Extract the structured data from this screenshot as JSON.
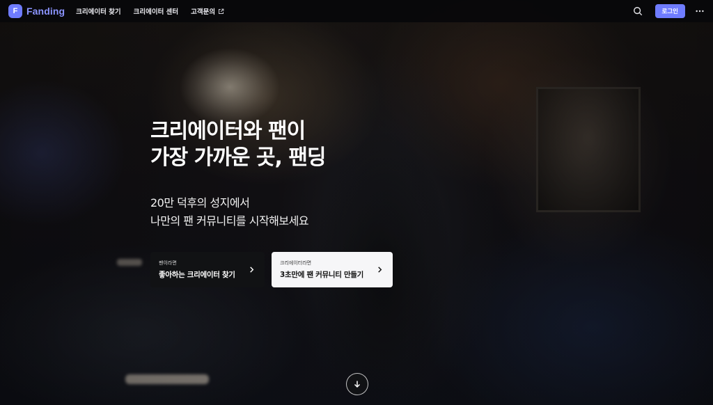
{
  "brand": {
    "name": "Fanding",
    "mark": "F"
  },
  "nav": {
    "links": [
      {
        "label": "크리에이터 찾기"
      },
      {
        "label": "크리에이터 센터"
      },
      {
        "label": "고객문의"
      }
    ],
    "login_label": "로그인"
  },
  "hero": {
    "title_line1": "크리에이터와 팬이",
    "title_line2": "가장 가까운 곳, 팬딩",
    "subtitle_line1": "20만 덕후의 성지에서",
    "subtitle_line2": "나만의 팬 커뮤니티를 시작해보세요",
    "cta_fan": {
      "caption": "팬이라면",
      "label": "좋아하는 크리에이터 찾기"
    },
    "cta_creator": {
      "caption": "크리에이터라면",
      "label": "3초만에 팬 커뮤니티 만들기"
    }
  },
  "icons": {
    "search": "search-icon",
    "more": "more-horizontal-icon",
    "external": "external-link-icon",
    "chevron": "chevron-right-icon",
    "scroll": "arrow-down-icon"
  },
  "colors": {
    "accent": "#6f7cff",
    "brand_text": "#8b94ff",
    "cta_dark": "#111214",
    "cta_light": "#f6f6f8"
  }
}
